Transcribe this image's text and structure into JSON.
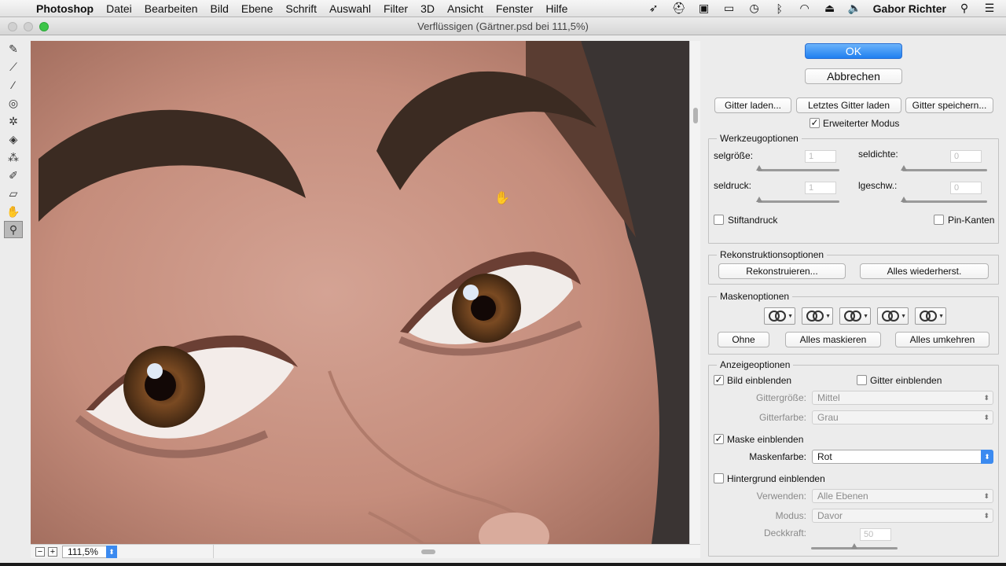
{
  "menubar": {
    "apple": "",
    "items": [
      "Photoshop",
      "Datei",
      "Bearbeiten",
      "Bild",
      "Ebene",
      "Schrift",
      "Auswahl",
      "Filter",
      "3D",
      "Ansicht",
      "Fenster",
      "Hilfe"
    ],
    "user": "Gabor Richter",
    "status_icons": [
      "wing-icon",
      "hat-icon",
      "display-icon",
      "airplay-icon",
      "time-machine-icon",
      "bluetooth-icon",
      "wifi-icon",
      "eject-icon",
      "volume-icon",
      "search-icon",
      "list-icon"
    ]
  },
  "window": {
    "title": "Verflüssigen (Gärtner.psd bei 111,5%)"
  },
  "tools": [
    "forward-warp-icon",
    "reconstruct-icon",
    "smooth-icon",
    "twirl-icon",
    "pucker-icon",
    "bloat-icon",
    "push-left-icon",
    "freeze-mask-icon",
    "thaw-mask-icon",
    "hand-icon",
    "zoom-icon"
  ],
  "status": {
    "zoom_value": "111,5%",
    "zoom_out": "−",
    "zoom_in": "+"
  },
  "panel": {
    "ok": "OK",
    "cancel": "Abbrechen",
    "load_mesh": "Gitter laden...",
    "load_last_mesh": "Letztes Gitter laden",
    "save_mesh": "Gitter speichern...",
    "advanced_mode": "Erweiterter Modus",
    "tool_options": {
      "title": "Werkzeugoptionen",
      "brush_size": "selgröße:",
      "brush_size_value": "1",
      "brush_density": "seldichte:",
      "brush_density_value": "0",
      "brush_pressure": "seldruck:",
      "brush_pressure_value": "1",
      "brush_rate": "lgeschw.:",
      "brush_rate_value": "0",
      "stylus_pressure": "Stiftandruck",
      "pin_edges": "Pin-Kanten"
    },
    "reconstruct_options": {
      "title": "Rekonstruktionsoptionen",
      "reconstruct": "Rekonstruieren...",
      "restore_all": "Alles wiederherst."
    },
    "mask_options": {
      "title": "Maskenoptionen",
      "none": "Ohne",
      "mask_all": "Alles maskieren",
      "invert_all": "Alles umkehren"
    },
    "view_options": {
      "title": "Anzeigeoptionen",
      "show_image": "Bild einblenden",
      "show_mesh": "Gitter einblenden",
      "mesh_size_label": "Gittergröße:",
      "mesh_size_value": "Mittel",
      "mesh_color_label": "Gitterfarbe:",
      "mesh_color_value": "Grau",
      "show_mask": "Maske einblenden",
      "mask_color_label": "Maskenfarbe:",
      "mask_color_value": "Rot",
      "show_backdrop": "Hintergrund einblenden",
      "use_label": "Verwenden:",
      "use_value": "Alle Ebenen",
      "mode_label": "Modus:",
      "mode_value": "Davor",
      "opacity_label": "Deckkraft:",
      "opacity_value": "50"
    }
  },
  "colors": {
    "accent": "#1f7ff0",
    "maximize": "#3cc548"
  }
}
